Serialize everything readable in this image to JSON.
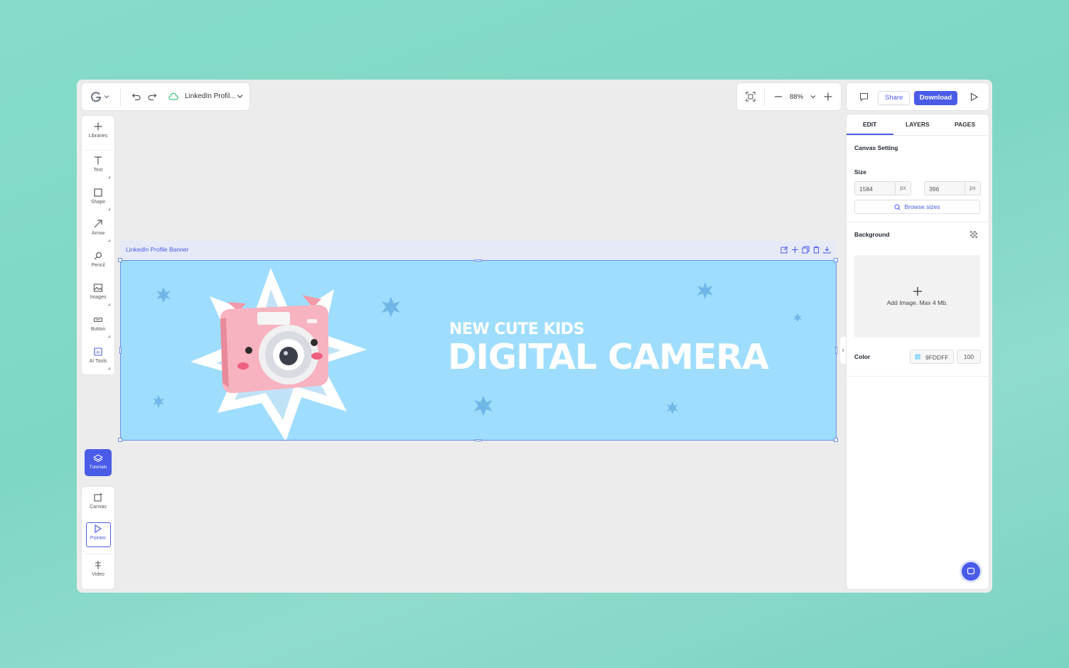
{
  "toolbar": {
    "document_name": "LinkedIn Profil...",
    "zoom": "88%",
    "share_label": "Share",
    "download_label": "Download"
  },
  "sidebar": {
    "tools": [
      {
        "label": "Libraries",
        "icon": "plus-icon"
      },
      {
        "label": "Text",
        "icon": "text-icon"
      },
      {
        "label": "Shape",
        "icon": "square-icon"
      },
      {
        "label": "Arrow",
        "icon": "arrow-icon"
      },
      {
        "label": "Pencil",
        "icon": "pencil-icon"
      },
      {
        "label": "Images",
        "icon": "image-icon"
      },
      {
        "label": "Button",
        "icon": "button-icon"
      },
      {
        "label": "AI Tools",
        "icon": "ai-icon"
      }
    ],
    "tutorials_label": "Tutorials",
    "bottom_tools": [
      {
        "label": "Canvas",
        "icon": "canvas-icon"
      },
      {
        "label": "Pointer",
        "icon": "pointer-icon"
      },
      {
        "label": "Video",
        "icon": "video-icon"
      }
    ]
  },
  "canvas": {
    "frame_title": "LinkedIn Profile Banner",
    "headline_small": "NEW CUTE KIDS",
    "headline_large": "DIGITAL CAMERA",
    "background_color": "#9fddff"
  },
  "panel": {
    "tabs": [
      "EDIT",
      "LAYERS",
      "PAGES"
    ],
    "canvas_setting_title": "Canvas Setting",
    "size_label": "Size",
    "width": "1584",
    "height": "396",
    "unit": "px",
    "browse_label": "Browse sizes",
    "background_label": "Background",
    "add_image_label": "Add Image. Max 4 Mb.",
    "color_label": "Color",
    "color_hex": "9FDDFF",
    "opacity": "100"
  },
  "colors": {
    "accent": "#4a5be8",
    "banner": "#9fddff",
    "stars": "#6fb7e6"
  }
}
